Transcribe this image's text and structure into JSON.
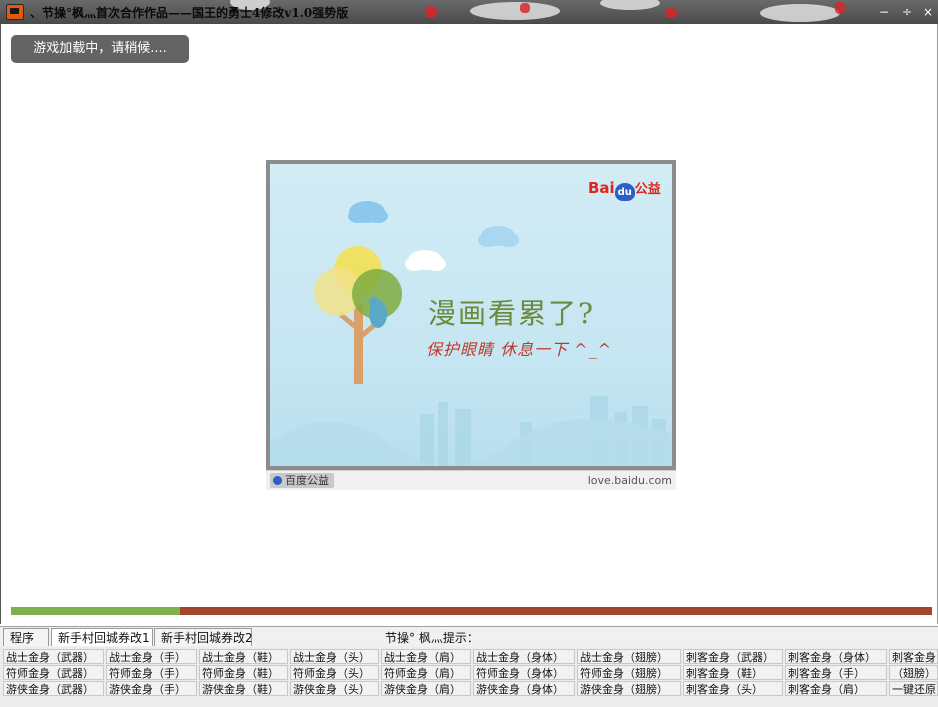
{
  "window": {
    "title": "、节操°枫灬首次合作作品——国王的勇士4修改v1.0强势版",
    "minimize": "−",
    "restore": "÷",
    "close": "×"
  },
  "loading": {
    "text": "游戏加载中，请稍候...."
  },
  "ad": {
    "brand_bai": "Bai",
    "brand_du": "du",
    "brand_suffix": "公益",
    "headline": "漫画看累了?",
    "subline": "保护眼睛 休息一下 ^_^",
    "footer_tag": "百度公益",
    "footer_url": "love.baidu.com"
  },
  "progress": {
    "fraction": 0.184
  },
  "tabs": [
    {
      "label": "程序",
      "active": false
    },
    {
      "label": "新手村回城券改1",
      "active": true
    },
    {
      "label": "新手村回城券改2",
      "active": false
    }
  ],
  "hint": "节操° 枫灬提示：",
  "buttons": {
    "row1": [
      "战士金身（武器）",
      "战士金身（手）",
      "战士金身（鞋）",
      "战士金身（头）",
      "战士金身（肩）",
      "战士金身（身体）",
      "战士金身（翅膀）",
      "刺客金身（武器）",
      "刺客金身（身体）",
      "刺客金身"
    ],
    "row2": [
      "符师金身（武器）",
      "符师金身（手）",
      "符师金身（鞋）",
      "符师金身（头）",
      "符师金身（肩）",
      "符师金身（身体）",
      "符师金身（翅膀）",
      "刺客金身（鞋）",
      "刺客金身（手）",
      "（翅膀）"
    ],
    "row3": [
      "游侠金身（武器）",
      "游侠金身（手）",
      "游侠金身（鞋）",
      "游侠金身（头）",
      "游侠金身（肩）",
      "游侠金身（身体）",
      "游侠金身（翅膀）",
      "刺客金身（头）",
      "刺客金身（肩）",
      "一键还原"
    ]
  },
  "colors": {
    "progress_done": "#7fb04e",
    "progress_rest": "#a0462e",
    "ad_accent": "#e1251b"
  }
}
